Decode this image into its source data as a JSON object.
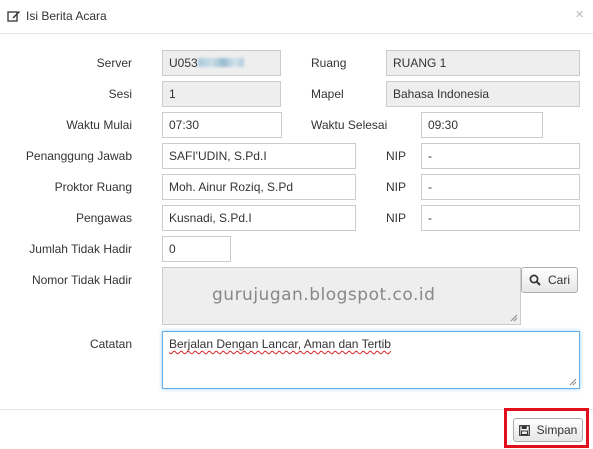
{
  "dialog": {
    "title": "Isi Berita Acara",
    "close_label": "×"
  },
  "form": {
    "server_label": "Server",
    "server_value_visible": "U053",
    "ruang_label": "Ruang",
    "ruang_value": "RUANG 1",
    "sesi_label": "Sesi",
    "sesi_value": "1",
    "mapel_label": "Mapel",
    "mapel_value": "Bahasa Indonesia",
    "waktu_mulai_label": "Waktu Mulai",
    "waktu_mulai_value": "07:30",
    "waktu_selesai_label": "Waktu Selesai",
    "waktu_selesai_value": "09:30",
    "penanggung_label": "Penanggung Jawab",
    "penanggung_value": "SAFI'UDIN, S.Pd.I",
    "penanggung_nip_label": "NIP",
    "penanggung_nip_value": "-",
    "proktor_label": "Proktor Ruang",
    "proktor_value": "Moh. Ainur Roziq, S.Pd",
    "proktor_nip_label": "NIP",
    "proktor_nip_value": "-",
    "pengawas_label": "Pengawas",
    "pengawas_value": "Kusnadi, S.Pd.I",
    "pengawas_nip_label": "NIP",
    "pengawas_nip_value": "-",
    "jumlah_label": "Jumlah Tidak Hadir",
    "jumlah_value": "0",
    "nomor_label": "Nomor Tidak Hadir",
    "cari_label": "Cari",
    "catatan_label": "Catatan",
    "catatan_value": "Berjalan Dengan Lancar, Aman dan Tertib"
  },
  "watermark": "gurujugan.blogspot.co.id",
  "footer": {
    "simpan_label": "Simpan"
  },
  "colors": {
    "highlight": "#e30e1b",
    "focus_border": "#66afe9",
    "readonly_bg": "#eeeeee"
  },
  "icons": [
    "edit-icon",
    "search-icon",
    "save-icon"
  ]
}
